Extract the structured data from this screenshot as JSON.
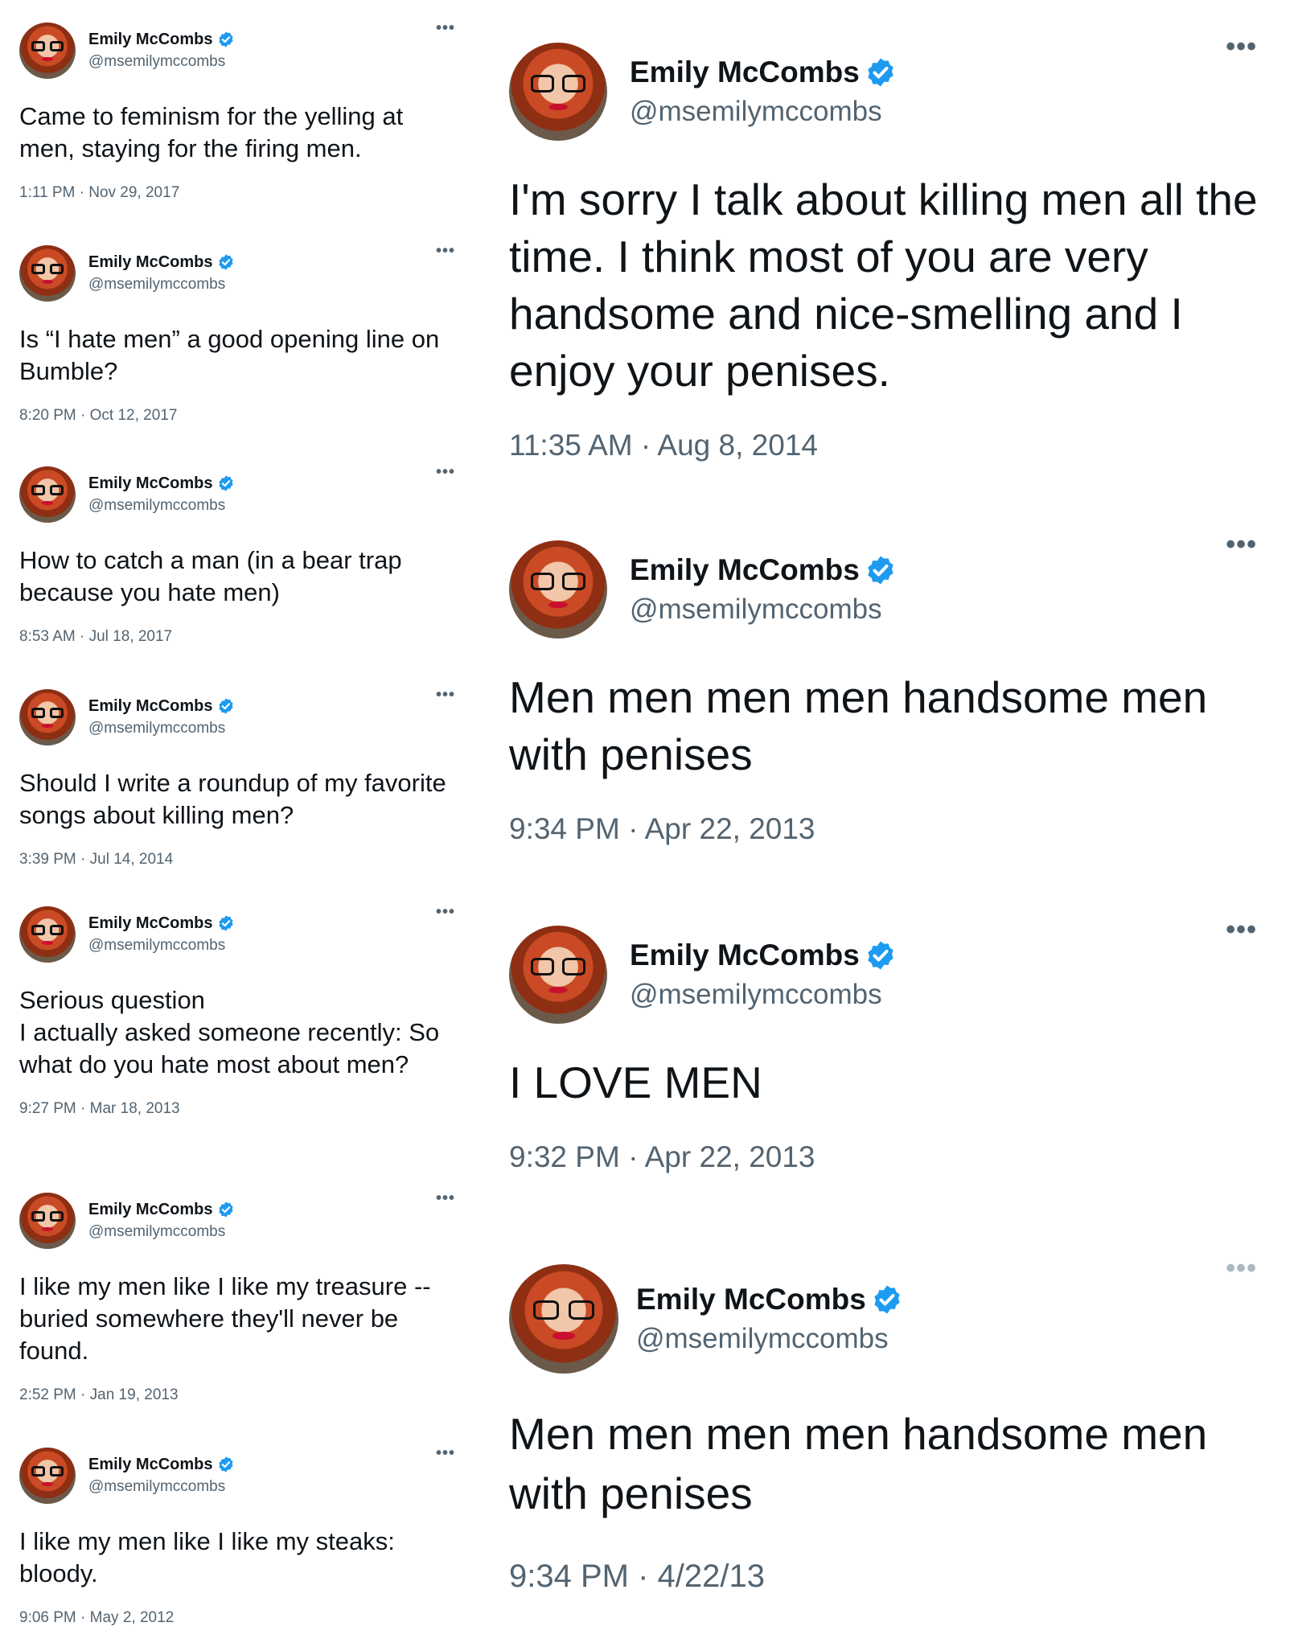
{
  "profile": {
    "name": "Emily McCombs",
    "handle": "@msemilymccombs",
    "more_label": "•••"
  },
  "colors": {
    "verified_blue": "#1d9bf0",
    "text": "#0f1419",
    "muted": "#536471"
  },
  "icons": {
    "verified": "verified-badge-icon",
    "more": "more-options-icon"
  },
  "left_tweets": [
    {
      "text": "Came to feminism for the yelling at men, staying for the firing men.",
      "time": "1:11 PM · Nov 29, 2017"
    },
    {
      "text": "Is “I hate men” a good opening line on Bumble?",
      "time": "8:20 PM · Oct 12, 2017"
    },
    {
      "text": "How to catch a man (in a bear trap because you hate men)",
      "time": "8:53 AM · Jul 18, 2017"
    },
    {
      "text": "Should I write a roundup of my favorite songs about killing men?",
      "time": "3:39 PM · Jul 14, 2014"
    },
    {
      "text": "Serious question\nI actually asked someone recently: So what do you hate most about men?",
      "time": "9:27 PM · Mar 18, 2013"
    },
    {
      "text": "I like my men like I like my treasure -- buried somewhere they'll never be found.",
      "time": "2:52 PM · Jan 19, 2013"
    },
    {
      "text": "I like my men like I like my steaks: bloody.",
      "time": "9:06 PM · May 2, 2012"
    }
  ],
  "right_tweets": [
    {
      "text": "I'm sorry I talk about killing men all the time. I think most of you are very handsome and nice-smelling and I enjoy your penises.",
      "time": "11:35 AM · Aug 8, 2014"
    },
    {
      "text": "Men men men men handsome men with penises",
      "time": "9:34 PM · Apr 22, 2013"
    },
    {
      "text": "I LOVE MEN",
      "time": "9:32 PM · Apr 22, 2013"
    },
    {
      "text": "Men men men men handsome men with penises",
      "time": "9:34 PM · 4/22/13"
    }
  ]
}
